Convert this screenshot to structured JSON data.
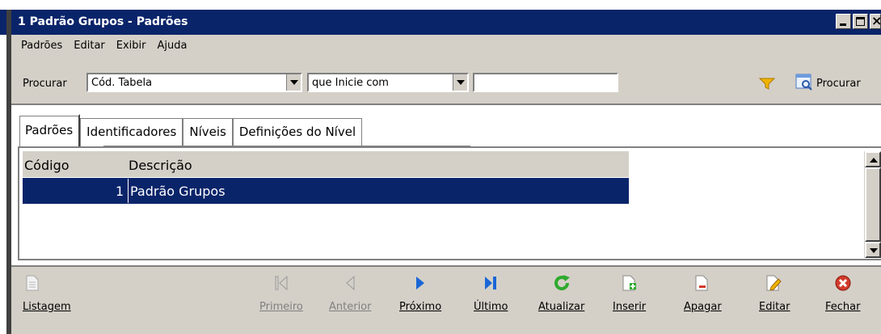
{
  "window": {
    "title": "1 Padrão Grupos - Padrões"
  },
  "menu": [
    "Padrões",
    "Editar",
    "Exibir",
    "Ajuda"
  ],
  "search": {
    "label": "Procurar",
    "field": "Cód. Tabela",
    "operator": "que Inicie com",
    "value": "",
    "button_label": "Procurar"
  },
  "tabs": [
    {
      "label": "Padrões",
      "active": true
    },
    {
      "label": "Identificadores",
      "active": false
    },
    {
      "label": "Níveis",
      "active": false
    },
    {
      "label": "Definições do Nível",
      "active": false
    }
  ],
  "grid": {
    "columns": [
      "Código",
      "Descrição"
    ],
    "rows": [
      {
        "codigo": "1",
        "descricao": "Padrão Grupos",
        "selected": true
      }
    ]
  },
  "toolbar": {
    "listagem": "Listagem",
    "primeiro": "Primeiro",
    "anterior": "Anterior",
    "proximo": "Próximo",
    "ultimo": "Último",
    "atualizar": "Atualizar",
    "inserir": "Inserir",
    "apagar": "Apagar",
    "editar": "Editar",
    "fechar": "Fechar"
  },
  "colors": {
    "titlebar": "#0a246a",
    "selection": "#0a246a",
    "face": "#d4d0c8",
    "nav_blue": "#1a66d6",
    "refresh_green": "#2eaa2e",
    "close_red": "#d23a2a"
  }
}
